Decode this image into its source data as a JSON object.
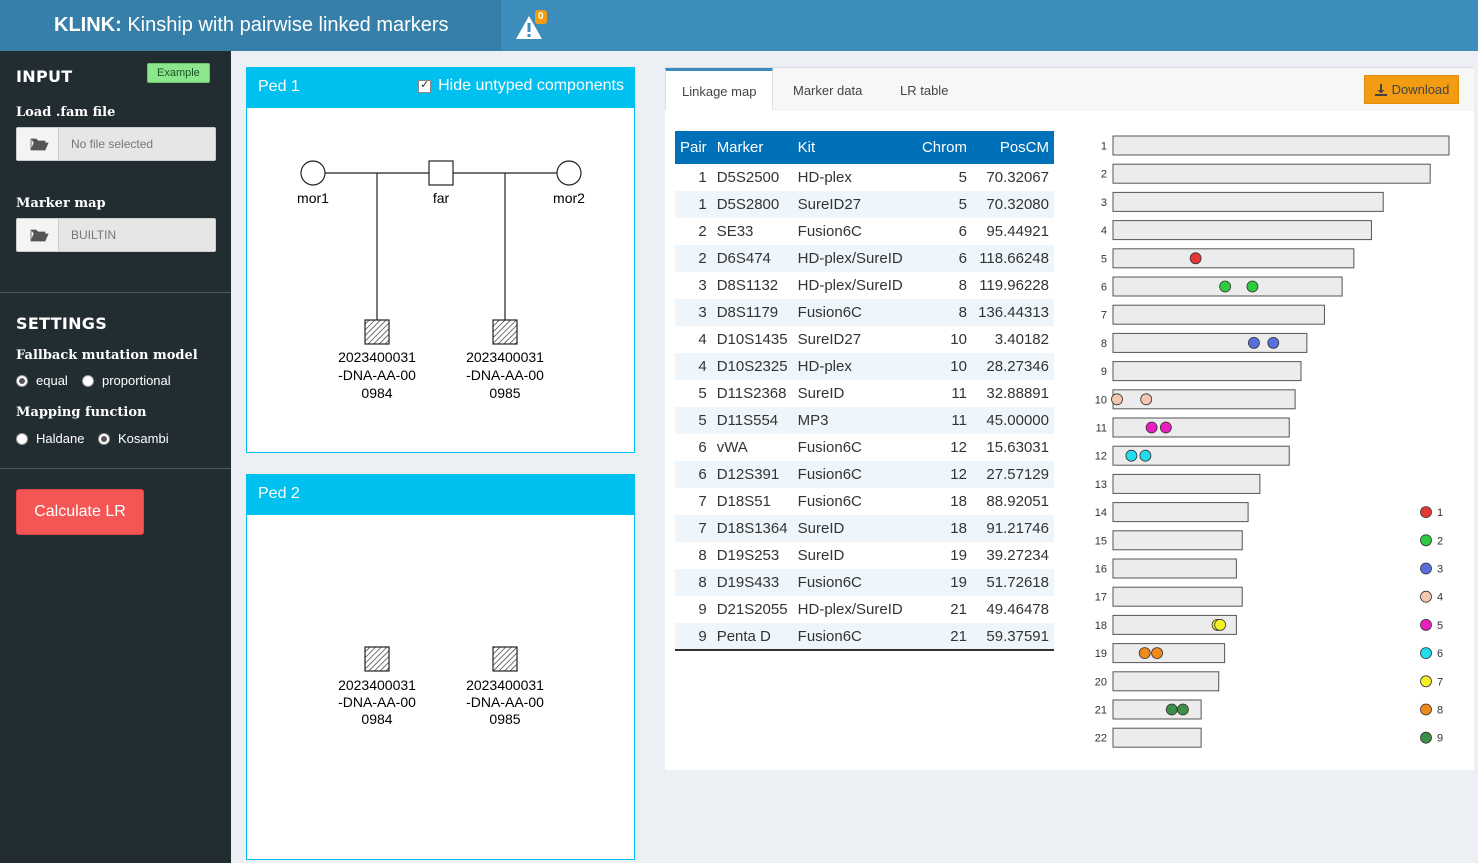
{
  "header": {
    "title_bold": "KLINK:",
    "title_rest": " Kinship with pairwise linked markers",
    "warning_count": "0"
  },
  "sidebar": {
    "input_heading": "INPUT",
    "example_label": "Example",
    "fam_label": "Load .fam file",
    "fam_placeholder": "No file selected",
    "marker_map_label": "Marker map",
    "marker_map_value": "BUILTIN",
    "settings_heading": "SETTINGS",
    "fallback_label": "Fallback mutation model",
    "fallback_options": [
      "equal",
      "proportional"
    ],
    "fallback_selected": "equal",
    "mapping_label": "Mapping function",
    "mapping_options": [
      "Haldane",
      "Kosambi"
    ],
    "mapping_selected": "Kosambi",
    "calc_label": "Calculate LR"
  },
  "ped1": {
    "title": "Ped 1",
    "hide_label": "Hide untyped components",
    "hide_checked": true,
    "names": {
      "mor1": "mor1",
      "far": "far",
      "mor2": "mor2"
    },
    "child1": [
      "2023400031",
      "-DNA-AA-00",
      "0984"
    ],
    "child2": [
      "2023400031",
      "-DNA-AA-00",
      "0985"
    ]
  },
  "ped2": {
    "title": "Ped 2",
    "ind1": [
      "2023400031",
      "-DNA-AA-00",
      "0984"
    ],
    "ind2": [
      "2023400031",
      "-DNA-AA-00",
      "0985"
    ]
  },
  "tabs": {
    "items": [
      "Linkage map",
      "Marker data",
      "LR table"
    ],
    "active": "Linkage map",
    "download_label": "Download"
  },
  "table": {
    "headers": [
      "Pair",
      "Marker",
      "Kit",
      "Chrom",
      "PosCM"
    ],
    "rows": [
      [
        "1",
        "D5S2500",
        "HD-plex",
        "5",
        "70.32067"
      ],
      [
        "1",
        "D5S2800",
        "SureID27",
        "5",
        "70.32080"
      ],
      [
        "2",
        "SE33",
        "Fusion6C",
        "6",
        "95.44921"
      ],
      [
        "2",
        "D6S474",
        "HD-plex/SureID",
        "6",
        "118.66248"
      ],
      [
        "3",
        "D8S1132",
        "HD-plex/SureID",
        "8",
        "119.96228"
      ],
      [
        "3",
        "D8S1179",
        "Fusion6C",
        "8",
        "136.44313"
      ],
      [
        "4",
        "D10S1435",
        "SureID27",
        "10",
        "3.40182"
      ],
      [
        "4",
        "D10S2325",
        "HD-plex",
        "10",
        "28.27346"
      ],
      [
        "5",
        "D11S2368",
        "SureID",
        "11",
        "32.88891"
      ],
      [
        "5",
        "D11S554",
        "MP3",
        "11",
        "45.00000"
      ],
      [
        "6",
        "vWA",
        "Fusion6C",
        "12",
        "15.63031"
      ],
      [
        "6",
        "D12S391",
        "Fusion6C",
        "12",
        "27.57129"
      ],
      [
        "7",
        "D18S51",
        "Fusion6C",
        "18",
        "88.92051"
      ],
      [
        "7",
        "D18S1364",
        "SureID",
        "18",
        "91.21746"
      ],
      [
        "8",
        "D19S253",
        "SureID",
        "19",
        "39.27234"
      ],
      [
        "8",
        "D19S433",
        "Fusion6C",
        "19",
        "51.72618"
      ],
      [
        "9",
        "D21S2055",
        "HD-plex/SureID",
        "21",
        "49.46478"
      ],
      [
        "9",
        "Penta D",
        "Fusion6C",
        "21",
        "59.37591"
      ]
    ]
  },
  "linkage_map": {
    "chrom_labels": [
      "1",
      "2",
      "3",
      "4",
      "5",
      "6",
      "7",
      "8",
      "9",
      "10",
      "11",
      "12",
      "13",
      "14",
      "15",
      "16",
      "17",
      "18",
      "19",
      "20",
      "21",
      "22"
    ],
    "chrom_lengths_cM": [
      286,
      270,
      230,
      220,
      205,
      195,
      180,
      165,
      160,
      155,
      150,
      150,
      125,
      115,
      110,
      105,
      110,
      105,
      95,
      90,
      75,
      75
    ],
    "pair_colors": [
      "#e53935",
      "#2ecc40",
      "#5b6ee1",
      "#f5c6b0",
      "#e91ec0",
      "#22ddee",
      "#f5ef28",
      "#f0891c",
      "#3d8f48"
    ],
    "legend_labels": [
      "1",
      "2",
      "3",
      "4",
      "5",
      "6",
      "7",
      "8",
      "9"
    ],
    "markers": [
      {
        "pair": 1,
        "chrom": 5,
        "pos": 70.32
      },
      {
        "pair": 2,
        "chrom": 6,
        "pos": 95.45
      },
      {
        "pair": 2,
        "chrom": 6,
        "pos": 118.66
      },
      {
        "pair": 3,
        "chrom": 8,
        "pos": 119.96
      },
      {
        "pair": 3,
        "chrom": 8,
        "pos": 136.44
      },
      {
        "pair": 4,
        "chrom": 10,
        "pos": 3.4
      },
      {
        "pair": 4,
        "chrom": 10,
        "pos": 28.27
      },
      {
        "pair": 5,
        "chrom": 11,
        "pos": 32.89
      },
      {
        "pair": 5,
        "chrom": 11,
        "pos": 45.0
      },
      {
        "pair": 6,
        "chrom": 12,
        "pos": 15.63
      },
      {
        "pair": 6,
        "chrom": 12,
        "pos": 27.57
      },
      {
        "pair": 7,
        "chrom": 18,
        "pos": 89.0
      },
      {
        "pair": 7,
        "chrom": 18,
        "pos": 91.2
      },
      {
        "pair": 8,
        "chrom": 19,
        "pos": 27.0
      },
      {
        "pair": 8,
        "chrom": 19,
        "pos": 37.5
      },
      {
        "pair": 9,
        "chrom": 21,
        "pos": 50.0
      },
      {
        "pair": 9,
        "chrom": 21,
        "pos": 59.5
      }
    ]
  }
}
